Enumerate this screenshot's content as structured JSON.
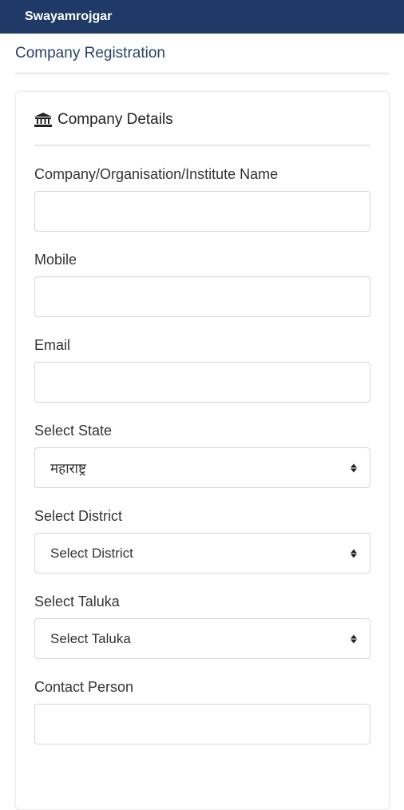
{
  "app": {
    "title": "Swayamrojgar"
  },
  "page": {
    "title": "Company Registration"
  },
  "card": {
    "title": "Company Details",
    "icon": "institution-icon"
  },
  "fields": {
    "company_name": {
      "label": "Company/Organisation/Institute Name",
      "value": ""
    },
    "mobile": {
      "label": "Mobile",
      "value": ""
    },
    "email": {
      "label": "Email",
      "value": ""
    },
    "state": {
      "label": "Select State",
      "selected": "महाराष्ट्र"
    },
    "district": {
      "label": "Select District",
      "selected": "Select District"
    },
    "taluka": {
      "label": "Select Taluka",
      "selected": "Select Taluka"
    },
    "contact_person": {
      "label": "Contact Person",
      "value": ""
    }
  },
  "colors": {
    "topbar": "#1f3a66",
    "page_title": "#2b4266"
  }
}
